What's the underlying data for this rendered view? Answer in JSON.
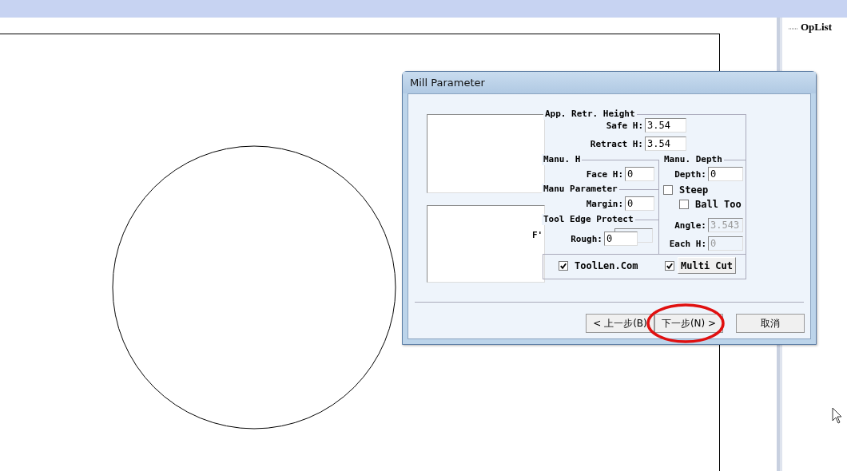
{
  "side_panel": {
    "tree_item": "OpList"
  },
  "dialog": {
    "title": "Mill Parameter",
    "group_titles": [
      "App.  Retr. Height",
      "Manu. H",
      "Manu. Depth",
      "Manu Parameter",
      "Tool Edge Protect"
    ],
    "stray_label": "F'",
    "fields": [
      {
        "label": "Safe H:",
        "value": "3.54",
        "disabled": false
      },
      {
        "label": "Retract H:",
        "value": "3.54",
        "disabled": false
      },
      {
        "label": "Face H:",
        "value": "0",
        "disabled": false
      },
      {
        "label": "Margin:",
        "value": "0",
        "disabled": false
      },
      {
        "label": "Rough:",
        "value": "0",
        "disabled": false
      },
      {
        "label": "Depth:",
        "value": "0",
        "disabled": false
      },
      {
        "label": "Angle:",
        "value": "3.543",
        "disabled": true
      },
      {
        "label": "Each H:",
        "value": "0",
        "disabled": true
      }
    ],
    "checkboxes": [
      {
        "label": "Steep",
        "checked": false
      },
      {
        "label": "Ball Too",
        "checked": false
      },
      {
        "label": "ToolLen.Com",
        "checked": true
      },
      {
        "checked": true
      }
    ],
    "multi_cut_button": "Multi Cut",
    "buttons": [
      {
        "label": "< 上一步(B)",
        "highlighted": false
      },
      {
        "label": "下一步(N) >",
        "highlighted": true
      },
      {
        "label": "取消",
        "highlighted": false
      }
    ]
  }
}
